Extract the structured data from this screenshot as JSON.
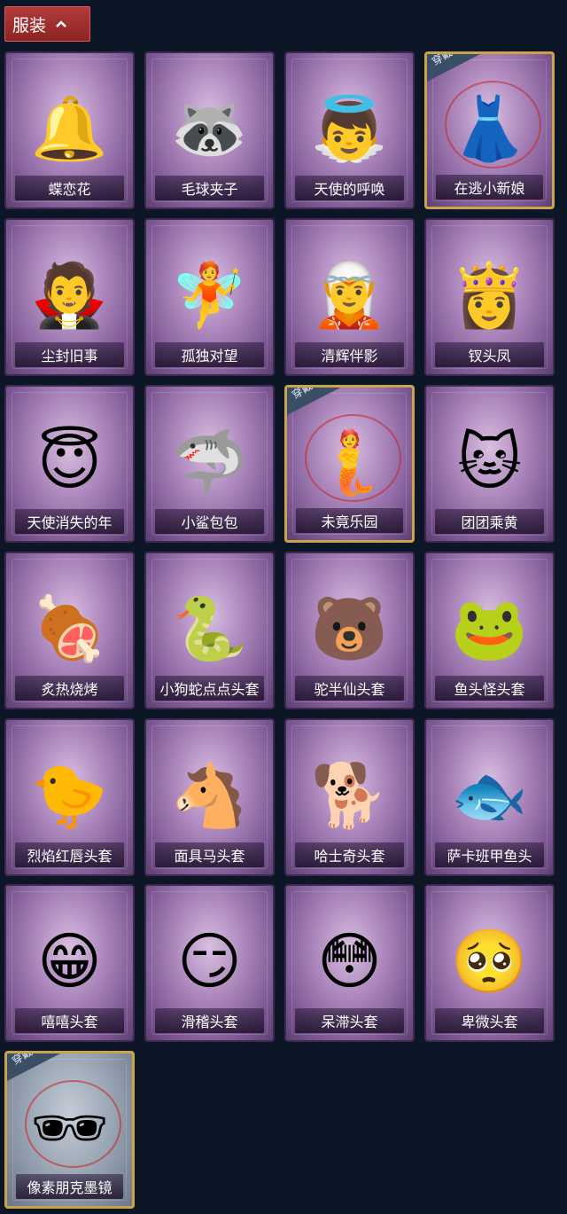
{
  "header": {
    "title": "服装"
  },
  "worn_badge": "穿戴",
  "items": [
    {
      "label": "蝶恋花",
      "icon": "bell-ornament-icon",
      "glyph": "🔔",
      "worn": false
    },
    {
      "label": "毛球夹子",
      "icon": "raccoon-drummer-icon",
      "glyph": "🦝",
      "worn": false
    },
    {
      "label": "天使的呼唤",
      "icon": "angel-doll-icon",
      "glyph": "👼",
      "worn": false
    },
    {
      "label": "在逃小新娘",
      "icon": "red-bride-dress-icon",
      "glyph": "👗",
      "worn": true
    },
    {
      "label": "尘封旧事",
      "icon": "dark-doll-icon",
      "glyph": "🧛",
      "worn": false
    },
    {
      "label": "孤独对望",
      "icon": "white-doll-icon",
      "glyph": "🧚",
      "worn": false
    },
    {
      "label": "清辉伴影",
      "icon": "silver-doll-icon",
      "glyph": "🧝",
      "worn": false
    },
    {
      "label": "钗头凤",
      "icon": "phoenix-crown-doll-icon",
      "glyph": "👸",
      "worn": false
    },
    {
      "label": "天使消失的年",
      "icon": "veiled-angel-icon",
      "glyph": "😇",
      "worn": false
    },
    {
      "label": "小鲨包包",
      "icon": "shark-bag-icon",
      "glyph": "🦈",
      "worn": false
    },
    {
      "label": "未竟乐园",
      "icon": "pink-star-doll-icon",
      "glyph": "🧜",
      "worn": true
    },
    {
      "label": "团团乘黄",
      "icon": "round-cat-icon",
      "glyph": "🐱",
      "worn": false
    },
    {
      "label": "炙热烧烤",
      "icon": "bbq-meat-mask-icon",
      "glyph": "🍖",
      "worn": false
    },
    {
      "label": "小狗蛇点点头套",
      "icon": "snake-mask-icon",
      "glyph": "🐍",
      "worn": false
    },
    {
      "label": "驼半仙头套",
      "icon": "bear-sunglasses-mask-icon",
      "glyph": "🐻",
      "worn": false
    },
    {
      "label": "鱼头怪头套",
      "icon": "fish-head-mask-icon",
      "glyph": "🐸",
      "worn": false
    },
    {
      "label": "烈焰红唇头套",
      "icon": "yellow-pikachu-mask-icon",
      "glyph": "🐤",
      "worn": false
    },
    {
      "label": "面具马头套",
      "icon": "horse-mask-icon",
      "glyph": "🐴",
      "worn": false
    },
    {
      "label": "哈士奇头套",
      "icon": "dog-sunglasses-mask-icon",
      "glyph": "🐕",
      "worn": false
    },
    {
      "label": "萨卡班甲鱼头",
      "icon": "fish-round-mask-icon",
      "glyph": "🐟",
      "worn": false
    },
    {
      "label": "嘻嘻头套",
      "icon": "grin-emoji-mask-icon",
      "glyph": "😁",
      "worn": false
    },
    {
      "label": "滑稽头套",
      "icon": "funny-emoji-mask-icon",
      "glyph": "😏",
      "worn": false
    },
    {
      "label": "呆滞头套",
      "icon": "stunned-emoji-mask-icon",
      "glyph": "😳",
      "worn": false
    },
    {
      "label": "卑微头套",
      "icon": "humble-emoji-mask-icon",
      "glyph": "🥺",
      "worn": false
    },
    {
      "label": "像素朋克墨镜",
      "icon": "pixel-sunglasses-icon",
      "glyph": "🕶",
      "worn": true,
      "style": "blue"
    }
  ]
}
